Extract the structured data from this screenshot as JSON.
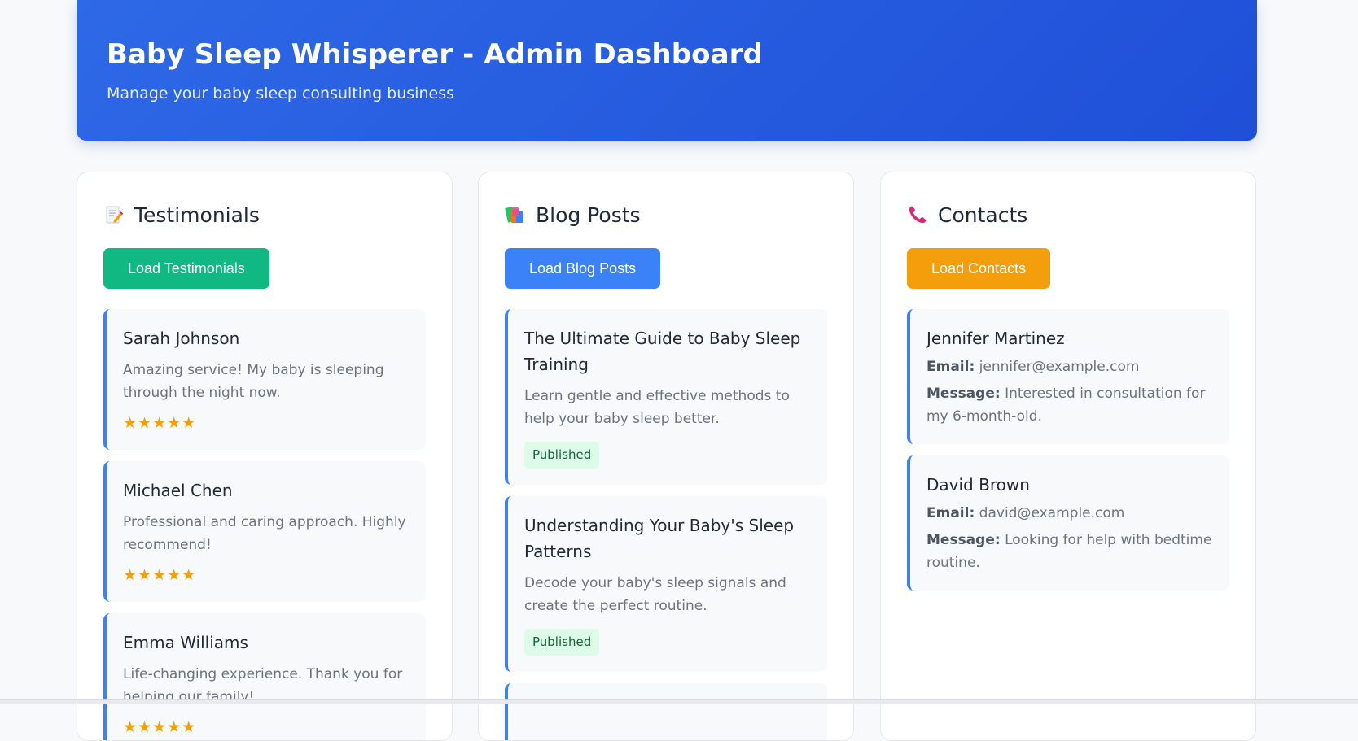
{
  "header": {
    "title": "Baby Sleep Whisperer - Admin Dashboard",
    "subtitle": "Manage your baby sleep consulting business"
  },
  "testimonials": {
    "icon": "memo-icon",
    "title": "Testimonials",
    "button_label": "Load Testimonials",
    "button_color": "#10b981",
    "items": [
      {
        "name": "Sarah Johnson",
        "text": "Amazing service! My baby is sleeping through the night now.",
        "rating": "★★★★★"
      },
      {
        "name": "Michael Chen",
        "text": "Professional and caring approach. Highly recommend!",
        "rating": "★★★★★"
      },
      {
        "name": "Emma Williams",
        "text": "Life-changing experience. Thank you for helping our family!",
        "rating": "★★★★★"
      }
    ]
  },
  "blog": {
    "icon": "books-icon",
    "title": "Blog Posts",
    "button_label": "Load Blog Posts",
    "button_color": "#3b82f6",
    "items": [
      {
        "title": "The Ultimate Guide to Baby Sleep Training",
        "excerpt": "Learn gentle and effective methods to help your baby sleep better.",
        "status": "Published"
      },
      {
        "title": "Understanding Your Baby's Sleep Patterns",
        "excerpt": "Decode your baby's sleep signals and create the perfect routine.",
        "status": "Published"
      }
    ]
  },
  "contacts": {
    "icon": "telephone-icon",
    "title": "Contacts",
    "button_label": "Load Contacts",
    "button_color": "#f59e0b",
    "email_label": "Email:",
    "message_label": "Message:",
    "items": [
      {
        "name": "Jennifer Martinez",
        "email": "jennifer@example.com",
        "message": "Interested in consultation for my 6-month-old."
      },
      {
        "name": "David Brown",
        "email": "david@example.com",
        "message": "Looking for help with bedtime routine."
      }
    ]
  },
  "colors": {
    "header_gradient_start": "#2e69e6",
    "header_gradient_end": "#1f4fd8",
    "card_accent": "#3b82f6",
    "star": "#f59e0b",
    "badge_bg": "#dcfce7",
    "badge_text": "#166534"
  }
}
